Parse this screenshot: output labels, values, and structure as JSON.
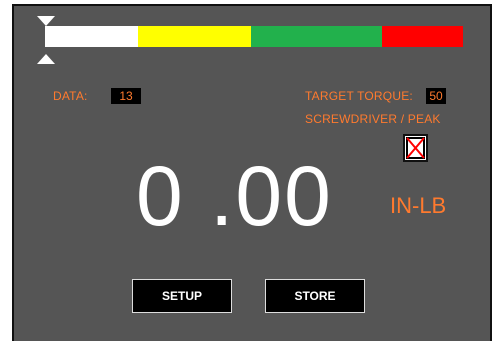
{
  "gauge": {
    "segments": [
      {
        "name": "white",
        "color": "#ffffff"
      },
      {
        "name": "yellow",
        "color": "#ffff00"
      },
      {
        "name": "green",
        "color": "#22b14c"
      },
      {
        "name": "red",
        "color": "#ff0000"
      }
    ]
  },
  "data": {
    "label": "DATA:",
    "value": "13"
  },
  "target": {
    "label": "TARGET  TORQUE:",
    "value": "50"
  },
  "mode": {
    "label": "SCREWDRIVER / PEAK"
  },
  "reading": {
    "value": "0 .00",
    "unit": "IN-LB"
  },
  "buttons": {
    "setup": "SETUP",
    "store": "STORE"
  },
  "colors": {
    "accent": "#ff7a2e",
    "panel": "#555555"
  }
}
